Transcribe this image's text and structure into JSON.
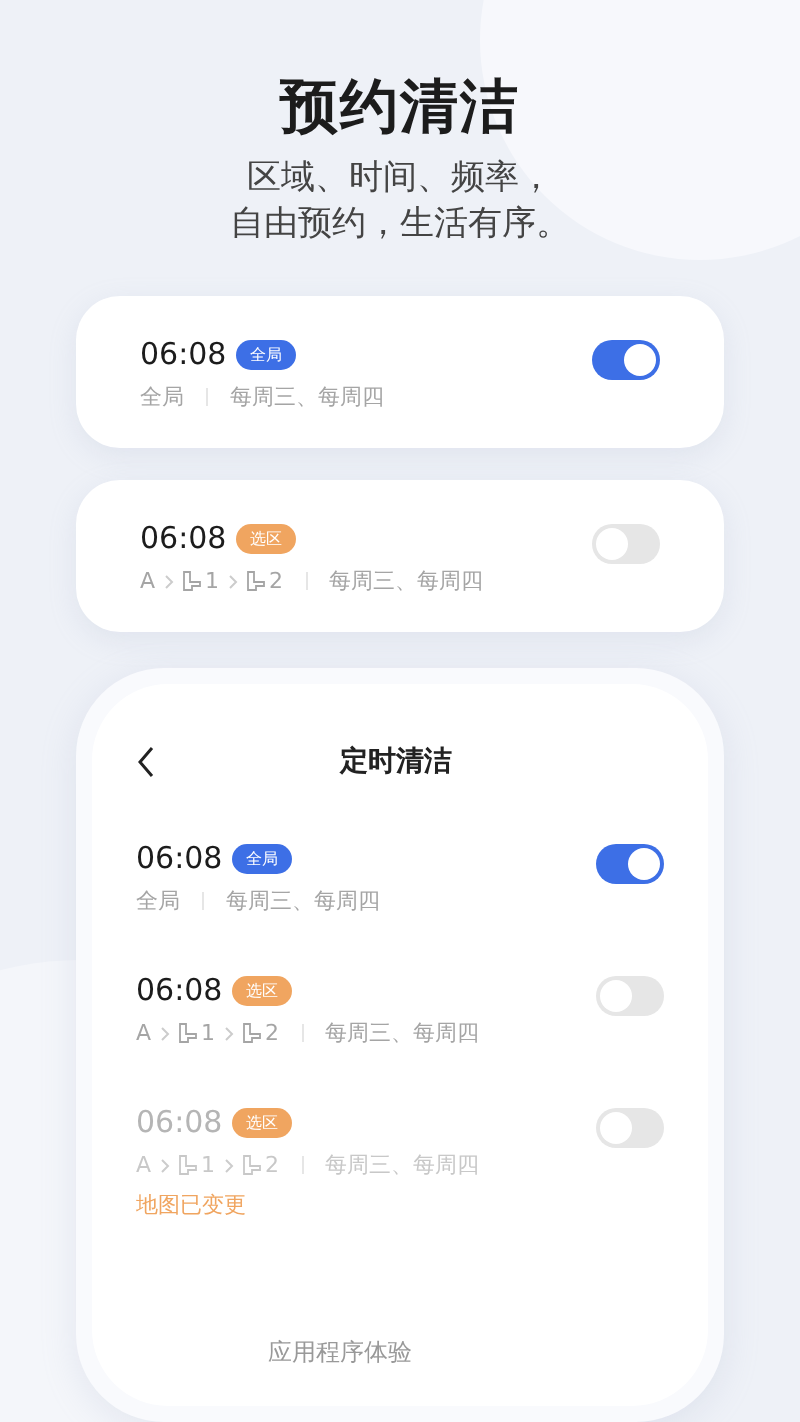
{
  "headline": "预约清洁",
  "subtitle": [
    "区域、时间、频率，",
    "自由预约，生活有序。"
  ],
  "cards": [
    {
      "time": "06:08",
      "tag": {
        "kind": "global",
        "text": "全局"
      },
      "on": true,
      "disabled": false,
      "path": [
        {
          "kind": "text",
          "text": "全局"
        }
      ],
      "days": "每周三、每周四"
    },
    {
      "time": "06:08",
      "tag": {
        "kind": "area",
        "text": "选区"
      },
      "on": false,
      "disabled": false,
      "path": [
        {
          "kind": "text",
          "text": "A"
        },
        {
          "kind": "room",
          "text": "1"
        },
        {
          "kind": "room",
          "text": "2"
        }
      ],
      "days": "每周三、每周四"
    }
  ],
  "phone": {
    "title": "定时清洁",
    "schedules": [
      {
        "time": "06:08",
        "tag": {
          "kind": "global",
          "text": "全局"
        },
        "on": true,
        "disabled": false,
        "path": [
          {
            "kind": "text",
            "text": "全局"
          }
        ],
        "days": "每周三、每周四"
      },
      {
        "time": "06:08",
        "tag": {
          "kind": "area",
          "text": "选区"
        },
        "on": false,
        "disabled": false,
        "path": [
          {
            "kind": "text",
            "text": "A"
          },
          {
            "kind": "room",
            "text": "1"
          },
          {
            "kind": "room",
            "text": "2"
          }
        ],
        "days": "每周三、每周四"
      },
      {
        "time": "06:08",
        "tag": {
          "kind": "area",
          "text": "选区"
        },
        "on": false,
        "disabled": true,
        "path": [
          {
            "kind": "text",
            "text": "A"
          },
          {
            "kind": "room",
            "text": "1"
          },
          {
            "kind": "room",
            "text": "2"
          }
        ],
        "days": "每周三、每周四",
        "warning": "地图已变更"
      }
    ],
    "footer": "应用程序体验"
  }
}
